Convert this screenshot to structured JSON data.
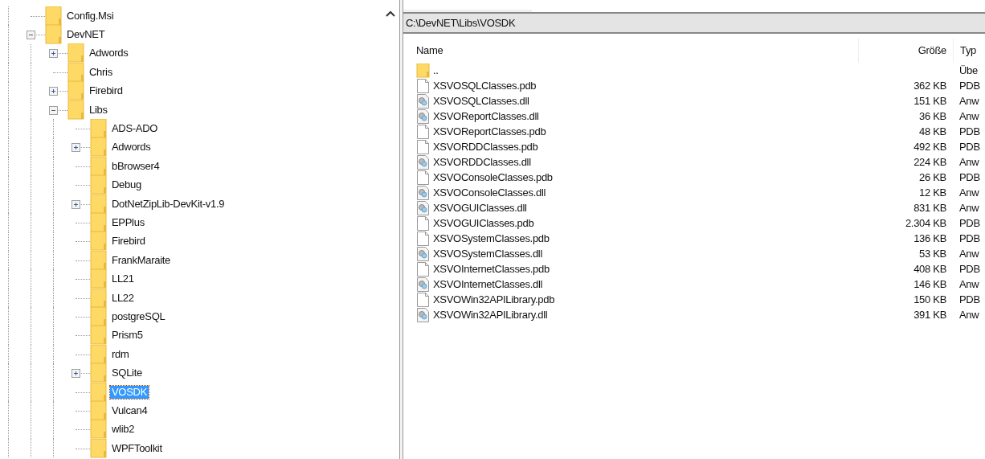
{
  "tree": [
    {
      "label": "Config.Msi",
      "kind": "leaf",
      "selected": false
    },
    {
      "label": "DevNET",
      "kind": "branch",
      "expanded": true,
      "selected": false,
      "children": [
        {
          "label": "Adwords",
          "kind": "branch",
          "expanded": false,
          "selected": false
        },
        {
          "label": "Chris",
          "kind": "leaf",
          "selected": false
        },
        {
          "label": "Firebird",
          "kind": "branch",
          "expanded": false,
          "selected": false
        },
        {
          "label": "Libs",
          "kind": "branch",
          "expanded": true,
          "selected": false,
          "children": [
            {
              "label": "ADS-ADO",
              "kind": "leaf",
              "selected": false
            },
            {
              "label": "Adwords",
              "kind": "branch",
              "expanded": false,
              "selected": false
            },
            {
              "label": "bBrowser4",
              "kind": "leaf",
              "selected": false
            },
            {
              "label": "Debug",
              "kind": "leaf",
              "selected": false
            },
            {
              "label": "DotNetZipLib-DevKit-v1.9",
              "kind": "branch",
              "expanded": false,
              "selected": false
            },
            {
              "label": "EPPlus",
              "kind": "leaf",
              "selected": false
            },
            {
              "label": "Firebird",
              "kind": "leaf",
              "selected": false
            },
            {
              "label": "FrankMaraite",
              "kind": "leaf",
              "selected": false
            },
            {
              "label": "LL21",
              "kind": "leaf",
              "selected": false
            },
            {
              "label": "LL22",
              "kind": "leaf",
              "selected": false
            },
            {
              "label": "postgreSQL",
              "kind": "leaf",
              "selected": false
            },
            {
              "label": "Prism5",
              "kind": "leaf",
              "selected": false
            },
            {
              "label": "rdm",
              "kind": "leaf",
              "selected": false
            },
            {
              "label": "SQLite",
              "kind": "branch",
              "expanded": false,
              "selected": false
            },
            {
              "label": "VOSDK",
              "kind": "leaf",
              "selected": true
            },
            {
              "label": "Vulcan4",
              "kind": "leaf",
              "selected": false
            },
            {
              "label": "wlib2",
              "kind": "leaf",
              "selected": false
            },
            {
              "label": "WPFToolkit",
              "kind": "leaf",
              "selected": false
            }
          ]
        }
      ]
    }
  ],
  "path": "C:\\DevNET\\Libs\\VOSDK",
  "columns": [
    "Name",
    "Größe",
    "Typ"
  ],
  "files": [
    {
      "kind": "folder",
      "name": "..",
      "type": "Übe"
    },
    {
      "kind": "pdb",
      "name": "XSVOSQLClasses.pdb",
      "size": "362 KB",
      "type": "PDB"
    },
    {
      "kind": "dll",
      "name": "XSVOSQLClasses.dll",
      "size": "151 KB",
      "type": "Anw"
    },
    {
      "kind": "dll",
      "name": "XSVOReportClasses.dll",
      "size": "36 KB",
      "type": "Anw"
    },
    {
      "kind": "pdb",
      "name": "XSVOReportClasses.pdb",
      "size": "48 KB",
      "type": "PDB"
    },
    {
      "kind": "pdb",
      "name": "XSVORDDClasses.pdb",
      "size": "492 KB",
      "type": "PDB"
    },
    {
      "kind": "dll",
      "name": "XSVORDDClasses.dll",
      "size": "224 KB",
      "type": "Anw"
    },
    {
      "kind": "pdb",
      "name": "XSVOConsoleClasses.pdb",
      "size": "26 KB",
      "type": "PDB"
    },
    {
      "kind": "dll",
      "name": "XSVOConsoleClasses.dll",
      "size": "12 KB",
      "type": "Anw"
    },
    {
      "kind": "dll",
      "name": "XSVOGUIClasses.dll",
      "size": "831 KB",
      "type": "Anw"
    },
    {
      "kind": "pdb",
      "name": "XSVOGUIClasses.pdb",
      "size": "2.304 KB",
      "type": "PDB"
    },
    {
      "kind": "pdb",
      "name": "XSVOSystemClasses.pdb",
      "size": "136 KB",
      "type": "PDB"
    },
    {
      "kind": "dll",
      "name": "XSVOSystemClasses.dll",
      "size": "53 KB",
      "type": "Anw"
    },
    {
      "kind": "pdb",
      "name": "XSVOInternetClasses.pdb",
      "size": "408 KB",
      "type": "PDB"
    },
    {
      "kind": "dll",
      "name": "XSVOInternetClasses.dll",
      "size": "146 KB",
      "type": "Anw"
    },
    {
      "kind": "pdb",
      "name": "XSVOWin32APILibrary.pdb",
      "size": "150 KB",
      "type": "PDB"
    },
    {
      "kind": "dll",
      "name": "XSVOWin32APILibrary.dll",
      "size": "391 KB",
      "type": "Anw"
    }
  ]
}
